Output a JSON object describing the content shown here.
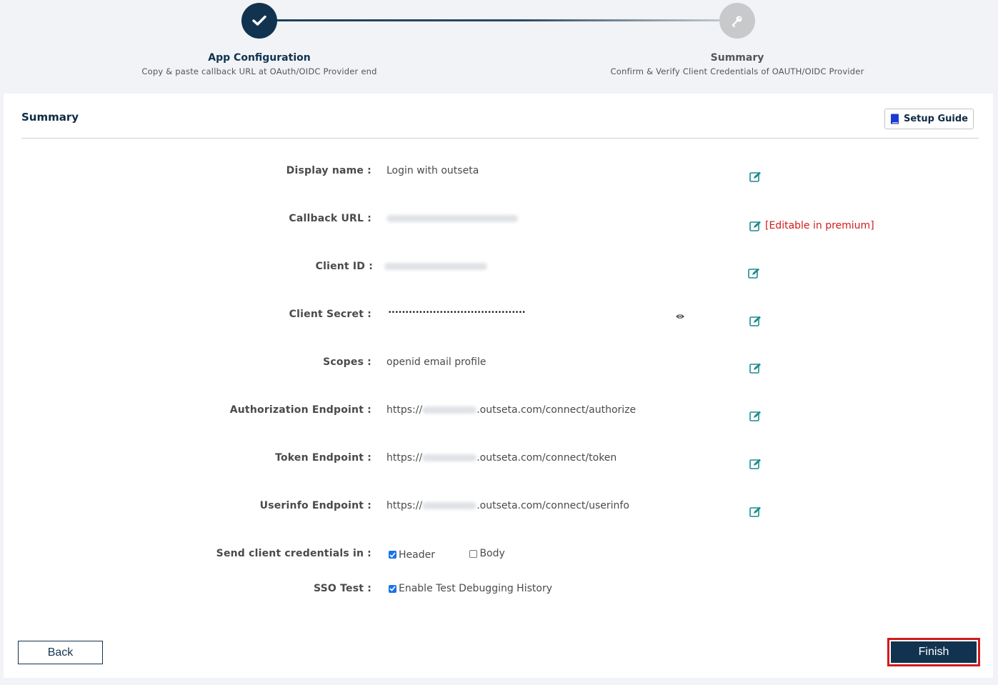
{
  "stepper": {
    "step1": {
      "title": "App Configuration",
      "subtitle": "Copy & paste callback URL at OAuth/OIDC Provider end",
      "status": "completed"
    },
    "step2": {
      "title": "Summary",
      "subtitle": "Confirm & Verify Client Credentials of OAUTH/OIDC Provider",
      "status": "pending"
    }
  },
  "card": {
    "title": "Summary",
    "setup_guide_label": "Setup Guide"
  },
  "fields": {
    "display_name": {
      "label": "Display name :",
      "value": "Login with outseta"
    },
    "callback_url": {
      "label": "Callback URL :",
      "premium_note": "[Editable in premium]"
    },
    "client_id": {
      "label": "Client ID :"
    },
    "client_secret": {
      "label": "Client Secret :",
      "value": "••••••••••••••••••••••••••••••••••••••••"
    },
    "scopes": {
      "label": "Scopes :",
      "value": "openid email profile"
    },
    "authorization_endpoint": {
      "label": "Authorization Endpoint :",
      "prefix": "https://",
      "suffix": ".outseta.com/connect/authorize"
    },
    "token_endpoint": {
      "label": "Token Endpoint :",
      "prefix": "https://",
      "suffix": ".outseta.com/connect/token"
    },
    "userinfo_endpoint": {
      "label": "Userinfo Endpoint :",
      "prefix": "https://",
      "suffix": ".outseta.com/connect/userinfo"
    },
    "send_credentials": {
      "label": "Send client credentials in :",
      "header_label": "Header",
      "header_checked": true,
      "body_label": "Body",
      "body_checked": false
    },
    "sso_test": {
      "label": "SSO Test :",
      "option_label": "Enable Test Debugging History",
      "checked": true
    }
  },
  "footer": {
    "back_label": "Back",
    "finish_label": "Finish"
  },
  "colors": {
    "primary": "#12334f",
    "accent_teal": "#1b8a8f",
    "danger": "#d11b1b"
  },
  "icons": [
    "check-icon",
    "key-icon",
    "book-icon",
    "edit-icon",
    "eye-icon"
  ]
}
